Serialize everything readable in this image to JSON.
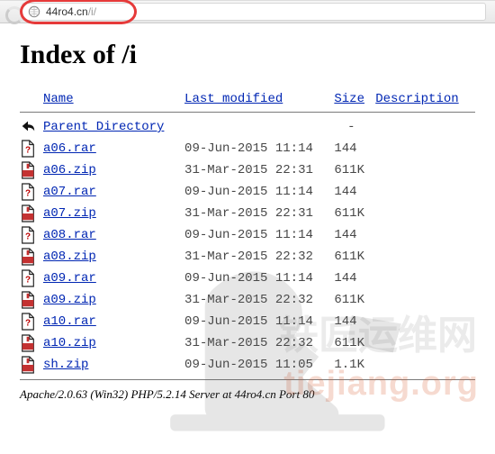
{
  "address": {
    "host": "44ro4.cn",
    "path": "/i/"
  },
  "heading": "Index of /i",
  "columns": {
    "name": "Name",
    "lastmod": "Last modified",
    "size": "Size",
    "desc": "Description"
  },
  "parent": {
    "label": "Parent Directory",
    "size": "-"
  },
  "rows": [
    {
      "icon": "unk",
      "name": "a06.rar",
      "lastmod": "09-Jun-2015 11:14",
      "size": "144"
    },
    {
      "icon": "zip",
      "name": "a06.zip",
      "lastmod": "31-Mar-2015 22:31",
      "size": "611K"
    },
    {
      "icon": "unk",
      "name": "a07.rar",
      "lastmod": "09-Jun-2015 11:14",
      "size": "144"
    },
    {
      "icon": "zip",
      "name": "a07.zip",
      "lastmod": "31-Mar-2015 22:31",
      "size": "611K"
    },
    {
      "icon": "unk",
      "name": "a08.rar",
      "lastmod": "09-Jun-2015 11:14",
      "size": "144"
    },
    {
      "icon": "zip",
      "name": "a08.zip",
      "lastmod": "31-Mar-2015 22:32",
      "size": "611K"
    },
    {
      "icon": "unk",
      "name": "a09.rar",
      "lastmod": "09-Jun-2015 11:14",
      "size": "144"
    },
    {
      "icon": "zip",
      "name": "a09.zip",
      "lastmod": "31-Mar-2015 22:32",
      "size": "611K"
    },
    {
      "icon": "unk",
      "name": "a10.rar",
      "lastmod": "09-Jun-2015 11:14",
      "size": "144"
    },
    {
      "icon": "zip",
      "name": "a10.zip",
      "lastmod": "31-Mar-2015 22:32",
      "size": "611K"
    },
    {
      "icon": "zip",
      "name": "sh.zip",
      "lastmod": "09-Jun-2015 11:05",
      "size": "1.1K"
    }
  ],
  "footer": "Apache/2.0.63 (Win32) PHP/5.2.14 Server at 44ro4.cn Port 80",
  "watermark": {
    "cn": "铁匠运维网",
    "domain": "tiejiang.org"
  }
}
